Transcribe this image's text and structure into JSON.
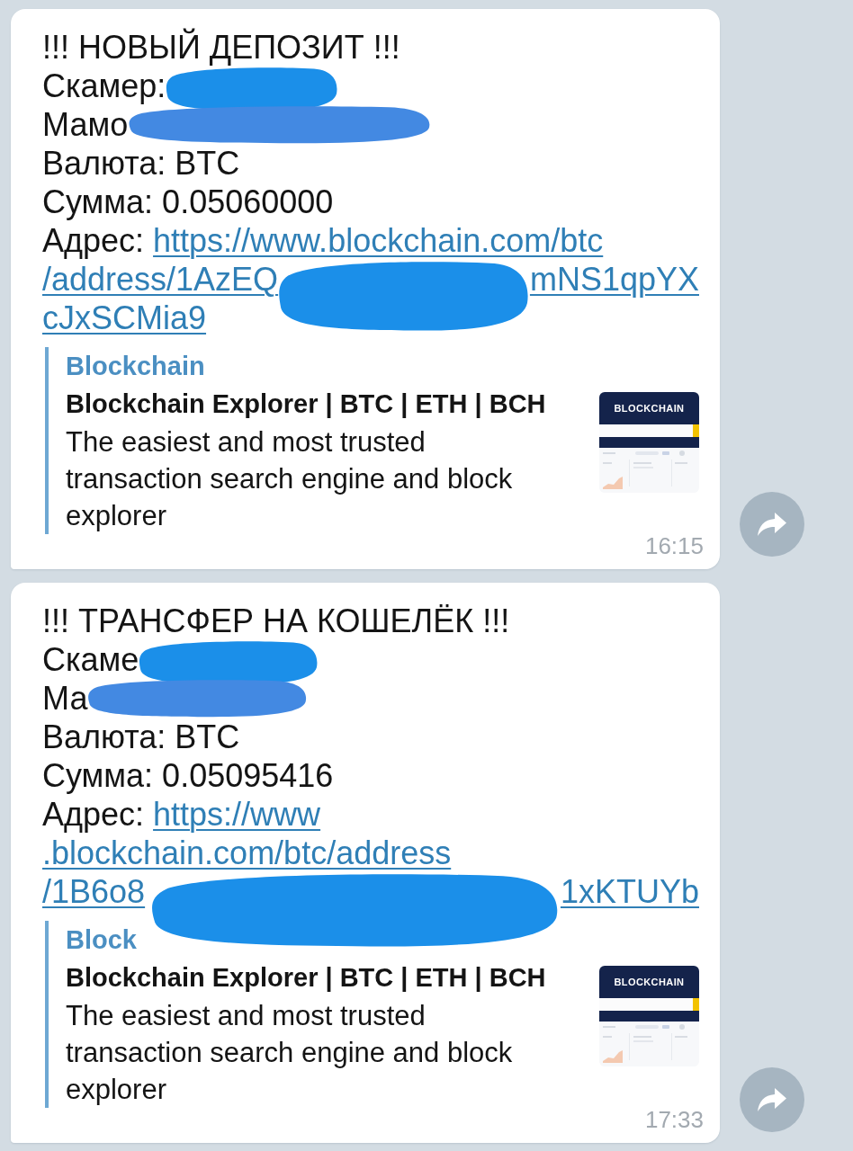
{
  "messages": [
    {
      "lines": [
        {
          "segments": [
            {
              "kind": "text",
              "text": "!!! НОВЫЙ ДЕПОЗИТ !!!"
            }
          ]
        },
        {
          "segments": [
            {
              "kind": "text",
              "text": "Скамер:"
            },
            {
              "kind": "redaction"
            }
          ]
        },
        {
          "segments": [
            {
              "kind": "text",
              "text": "Мамо"
            },
            {
              "kind": "redaction"
            }
          ]
        },
        {
          "segments": [
            {
              "kind": "text",
              "text": "Валюта: BTC"
            }
          ]
        },
        {
          "segments": [
            {
              "kind": "text",
              "text": "Сумма: 0.05060000"
            }
          ]
        },
        {
          "segments": [
            {
              "kind": "text",
              "text": "Адрес:"
            },
            {
              "kind": "link",
              "text": "https://www.blockchain.com/btc"
            }
          ]
        },
        {
          "segments": [
            {
              "kind": "link",
              "text": "/address/1AzEQ"
            },
            {
              "kind": "redaction"
            },
            {
              "kind": "link",
              "text": "mNS1qpYX"
            }
          ]
        },
        {
          "segments": [
            {
              "kind": "link",
              "text": "cJxSCMia9"
            }
          ]
        }
      ],
      "link_preview": {
        "site_name": "Blockchain",
        "title": "Blockchain Explorer | BTC | ETH | BCH",
        "description": "The easiest and most trusted transaction search engine and block explorer",
        "thumbnail": {
          "logo": "BLOCKCHAIN"
        }
      },
      "time": "16:15"
    },
    {
      "lines": [
        {
          "segments": [
            {
              "kind": "text",
              "text": "!!! ТРАНСФЕР НА КОШЕЛЁК !!!"
            }
          ]
        },
        {
          "segments": [
            {
              "kind": "text",
              "text": "Скаме"
            },
            {
              "kind": "redaction"
            }
          ]
        },
        {
          "segments": [
            {
              "kind": "text",
              "text": "Ма"
            },
            {
              "kind": "redaction"
            }
          ]
        },
        {
          "segments": [
            {
              "kind": "text",
              "text": "Валюта: BTC"
            }
          ]
        },
        {
          "segments": [
            {
              "kind": "text",
              "text": "Сумма: 0.05095416"
            }
          ]
        },
        {
          "segments": [
            {
              "kind": "text",
              "text": "Адрес:"
            },
            {
              "kind": "link",
              "text": "https://www"
            }
          ]
        },
        {
          "segments": [
            {
              "kind": "link",
              "text": ".blockchain.com/btc/address"
            }
          ]
        },
        {
          "segments": [
            {
              "kind": "link",
              "text": "/1B6o8"
            },
            {
              "kind": "redaction"
            },
            {
              "kind": "link",
              "text": "1xKTUYb"
            }
          ]
        }
      ],
      "link_preview": {
        "site_name": "Block",
        "title": "Blockchain Explorer | BTC | ETH | BCH",
        "description": "The easiest and most trusted transaction search engine and block explorer",
        "thumbnail": {
          "logo": "BLOCKCHAIN"
        }
      },
      "time": "17:33"
    }
  ]
}
